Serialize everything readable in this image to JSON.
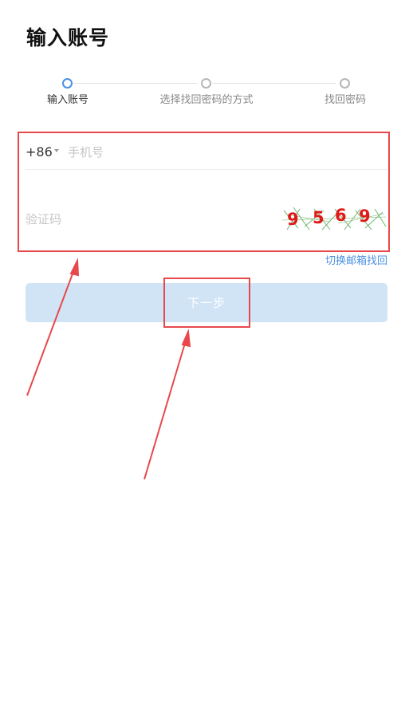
{
  "header": {
    "title": "输入账号"
  },
  "stepper": {
    "steps": [
      {
        "label": "输入账号",
        "active": true
      },
      {
        "label": "选择找回密码的方式",
        "active": false
      },
      {
        "label": "找回密码",
        "active": false
      }
    ]
  },
  "form": {
    "country_code": "+86",
    "phone_placeholder": "手机号",
    "code_placeholder": "验证码",
    "captcha_digits": [
      "9",
      "5",
      "6",
      "9"
    ]
  },
  "switch_link": "切换邮箱找回",
  "next_button": "下一步",
  "colors": {
    "accent": "#4a90e2",
    "button_bg": "#d0e4f6",
    "annotation": "#e8484b",
    "captcha_digit": "#e01818",
    "captcha_noise": "#5faa5a"
  }
}
